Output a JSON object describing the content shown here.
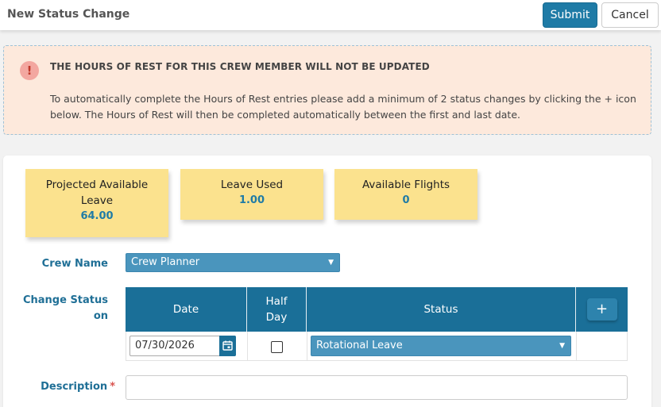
{
  "header": {
    "title": "New Status Change",
    "submit_label": "Submit",
    "cancel_label": "Cancel"
  },
  "alert": {
    "icon": "!",
    "title": "THE HOURS OF REST FOR THIS CREW MEMBER WILL NOT BE UPDATED",
    "body": "To automatically complete the Hours of Rest entries please add a minimum of 2 status changes by clicking the + icon below. The Hours of Rest will then be completed automatically between the first and last date."
  },
  "stats": [
    {
      "label": "Projected Available Leave",
      "value": "64.00"
    },
    {
      "label": "Leave Used",
      "value": "1.00"
    },
    {
      "label": "Available Flights",
      "value": "0"
    }
  ],
  "form": {
    "crew_name_label": "Crew Name",
    "crew_name_value": "Crew Planner",
    "change_status_label": "Change Status on",
    "description_label": "Description",
    "required_mark": "*"
  },
  "grid": {
    "headers": {
      "date": "Date",
      "half_day": "Half Day",
      "status": "Status",
      "add": "+"
    },
    "rows": [
      {
        "date": "07/30/2026",
        "half_day": false,
        "status": "Rotational Leave"
      }
    ]
  },
  "colors": {
    "accent": "#1a6f98",
    "alert_bg": "#fde9dc",
    "stat_bg": "#fbe28e"
  }
}
